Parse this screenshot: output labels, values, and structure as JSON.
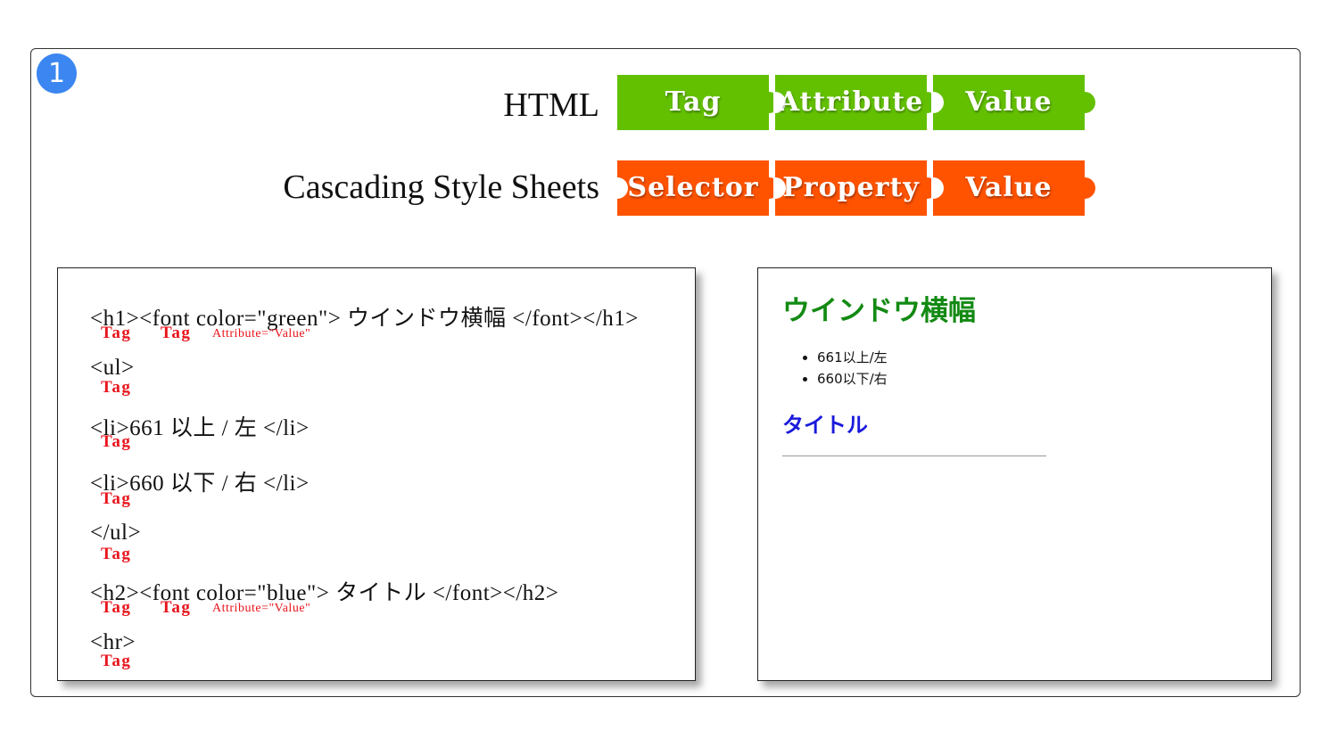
{
  "step_number": "1",
  "rows": {
    "html": {
      "label": "HTML",
      "pieces": [
        "Tag",
        "Attribute",
        "Value"
      ],
      "color": "#63c000"
    },
    "css": {
      "label": "Cascading Style Sheets",
      "pieces": [
        "Selector",
        "Property",
        "Value"
      ],
      "color": "#ff5300"
    }
  },
  "code": {
    "lines": [
      "<h1><font color=\"green\"> ウインドウ横幅 </font></h1>",
      "<ul>",
      "<li>661 以上 / 左 </li>",
      "<li>660 以下 / 右 </li>",
      "</ul>",
      "<h2><font color=\"blue\"> タイトル </font></h2>",
      "<hr>"
    ],
    "tag_label": "Tag",
    "attr_label": "Attribute=\"Value\""
  },
  "preview": {
    "h1": "ウインドウ横幅",
    "h1_color": "#138a13",
    "list": [
      "661以上/左",
      "660以下/右"
    ],
    "h2": "タイトル",
    "h2_color": "#1a1adc"
  }
}
